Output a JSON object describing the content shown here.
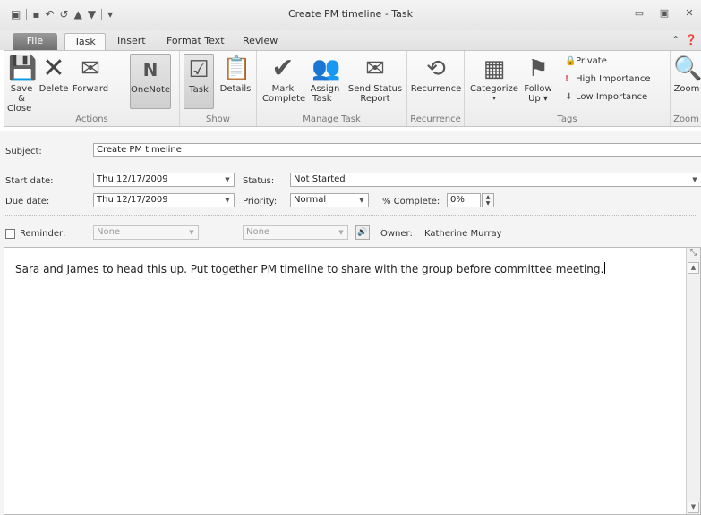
{
  "window": {
    "title": "Create PM timeline - Task",
    "qat_icons": [
      "save-icon",
      "undo-icon",
      "redo-icon",
      "up-icon",
      "down-icon",
      "customize-icon"
    ]
  },
  "tabs": {
    "file": "File",
    "task": "Task",
    "insert": "Insert",
    "format_text": "Format Text",
    "review": "Review"
  },
  "ribbon": {
    "actions": {
      "label": "Actions",
      "save_close": "Save &",
      "save_close2": "Close",
      "delete": "Delete",
      "forward": "Forward",
      "onenote": "OneNote"
    },
    "show": {
      "label": "Show",
      "task": "Task",
      "details": "Details"
    },
    "manage": {
      "label": "Manage Task",
      "mark": "Mark",
      "mark2": "Complete",
      "assign": "Assign",
      "assign2": "Task",
      "send": "Send Status",
      "send2": "Report"
    },
    "recurrence": {
      "label": "Recurrence",
      "recurrence": "Recurrence"
    },
    "tags": {
      "label": "Tags",
      "categorize": "Categorize",
      "follow": "Follow",
      "follow2": "Up",
      "private": "Private",
      "high": "High Importance",
      "low": "Low Importance"
    },
    "zoom": {
      "label": "Zoom",
      "zoom": "Zoom"
    }
  },
  "form": {
    "subject_label": "Subject:",
    "subject_value": "Create PM timeline",
    "start_label": "Start date:",
    "start_value": "Thu 12/17/2009",
    "due_label": "Due date:",
    "due_value": "Thu 12/17/2009",
    "status_label": "Status:",
    "status_value": "Not Started",
    "priority_label": "Priority:",
    "priority_value": "Normal",
    "complete_label": "% Complete:",
    "complete_value": "0%",
    "reminder_label": "Reminder:",
    "reminder_date": "None",
    "reminder_time": "None",
    "owner_label": "Owner:",
    "owner_value": "Katherine Murray",
    "notes": "Sara and James to head this up. Put together PM timeline to share with the group before committee meeting."
  }
}
